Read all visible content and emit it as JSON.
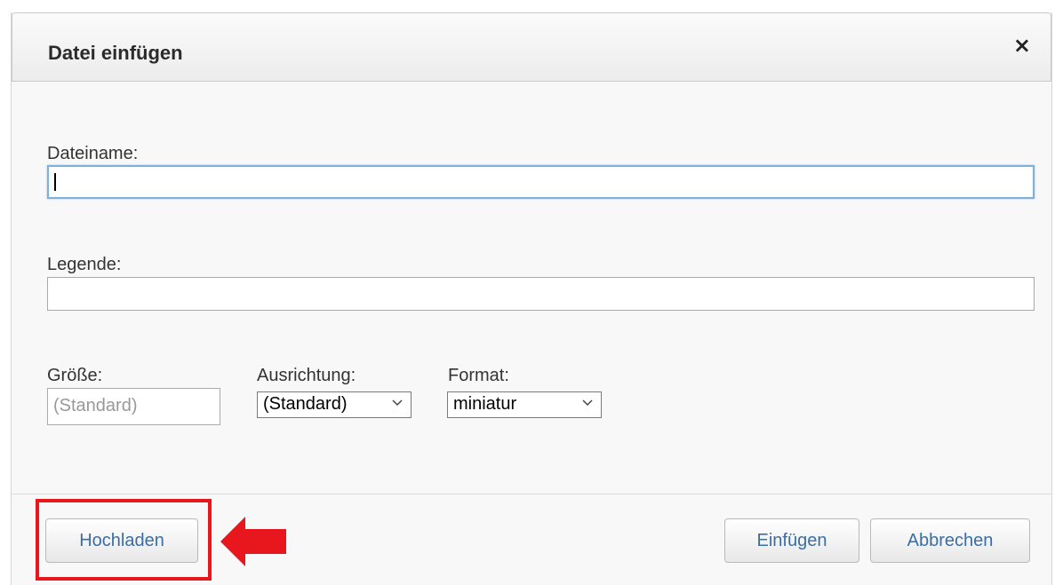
{
  "dialog": {
    "title": "Datei einfügen",
    "close_symbol": "×"
  },
  "form": {
    "filename_label": "Dateiname:",
    "filename_value": "",
    "caption_label": "Legende:",
    "caption_value": "",
    "size_label": "Größe:",
    "size_placeholder": "(Standard)",
    "alignment_label": "Ausrichtung:",
    "alignment_value": "(Standard)",
    "format_label": "Format:",
    "format_value": "miniatur"
  },
  "footer": {
    "upload_label": "Hochladen",
    "insert_label": "Einfügen",
    "cancel_label": "Abbrechen"
  },
  "annotation": {
    "highlight_color": "#e8161d",
    "arrow_color": "#e8161d",
    "icon": "arrow-left-icon"
  },
  "colors": {
    "button_text": "#3a6ea5",
    "focus_border": "#7fb0d8"
  }
}
